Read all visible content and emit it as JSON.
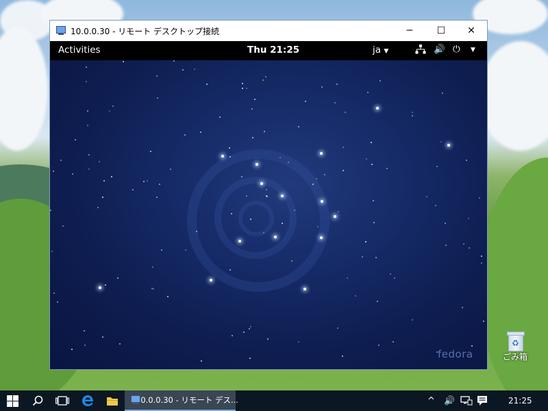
{
  "window": {
    "title": "10.0.0.30 - リモート デスクトップ接続",
    "minimize_glyph": "─",
    "maximize_glyph": "☐",
    "close_glyph": "✕"
  },
  "gnome": {
    "activities": "Activities",
    "clock": "Thu 21:25",
    "language": "ja",
    "dropdown_glyph": "▼",
    "network_icon": "network-icon",
    "volume_glyph": "🔊",
    "power_glyph": "⏻"
  },
  "wallpaper": {
    "brand": "fedora"
  },
  "desktop_icons": [
    {
      "label": "ごみ箱",
      "icon": "recycle-bin-icon"
    }
  ],
  "taskbar": {
    "running_app_label": "10.0.0.30 - リモート デス...",
    "tray_chevron": "^",
    "tray_volume": "🔊",
    "time": "21:25"
  },
  "colors": {
    "gnome_bar": "#000000",
    "space_background": "#0e1d50",
    "taskbar": "#0b1722",
    "titlebar": "#ffffff",
    "edge_blue": "#1e88e5",
    "folder_yellow": "#f2c94c"
  }
}
